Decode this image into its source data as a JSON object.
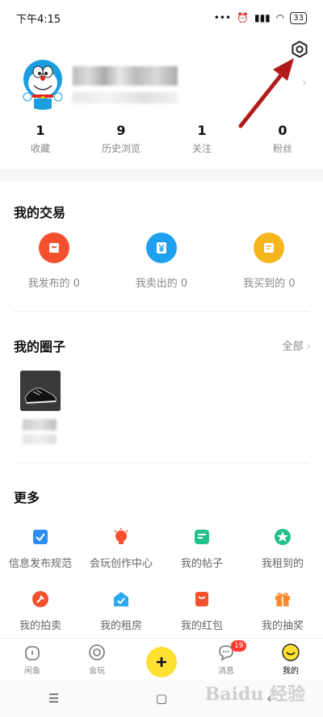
{
  "status_bar": {
    "time": "下午4:15",
    "battery": "33"
  },
  "stats": [
    {
      "value": "1",
      "label": "收藏"
    },
    {
      "value": "9",
      "label": "历史浏览"
    },
    {
      "value": "1",
      "label": "关注"
    },
    {
      "value": "0",
      "label": "粉丝"
    }
  ],
  "trade": {
    "title": "我的交易",
    "items": [
      {
        "label": "我发布的 0",
        "color": "#f4502d",
        "icon": "bag-icon"
      },
      {
        "label": "我卖出的 0",
        "color": "#1ea0f0",
        "icon": "yuan-icon"
      },
      {
        "label": "我买到的 0",
        "color": "#f6b51d",
        "icon": "list-icon"
      }
    ]
  },
  "circle": {
    "title": "我的圈子",
    "all_label": "全部"
  },
  "more": {
    "title": "更多",
    "row1": [
      {
        "label": "信息发布规范",
        "color": "#2a8ff2"
      },
      {
        "label": "会玩创作中心",
        "color": "#f4502d"
      },
      {
        "label": "我的帖子",
        "color": "#22c08a"
      },
      {
        "label": "我租到的",
        "color": "#22c08a"
      }
    ],
    "row2": [
      {
        "label": "我的拍卖",
        "color": "#f4502d"
      },
      {
        "label": "我的租房",
        "color": "#2aa8f0"
      },
      {
        "label": "我的红包",
        "color": "#f4502d"
      },
      {
        "label": "我的抽奖",
        "color": "#fa8a2d"
      }
    ]
  },
  "tabs": [
    {
      "label": "闲鱼"
    },
    {
      "label": "会玩"
    },
    {
      "label": ""
    },
    {
      "label": "消息",
      "badge": "19"
    },
    {
      "label": "我的"
    }
  ],
  "watermark": "Baidu 经验"
}
